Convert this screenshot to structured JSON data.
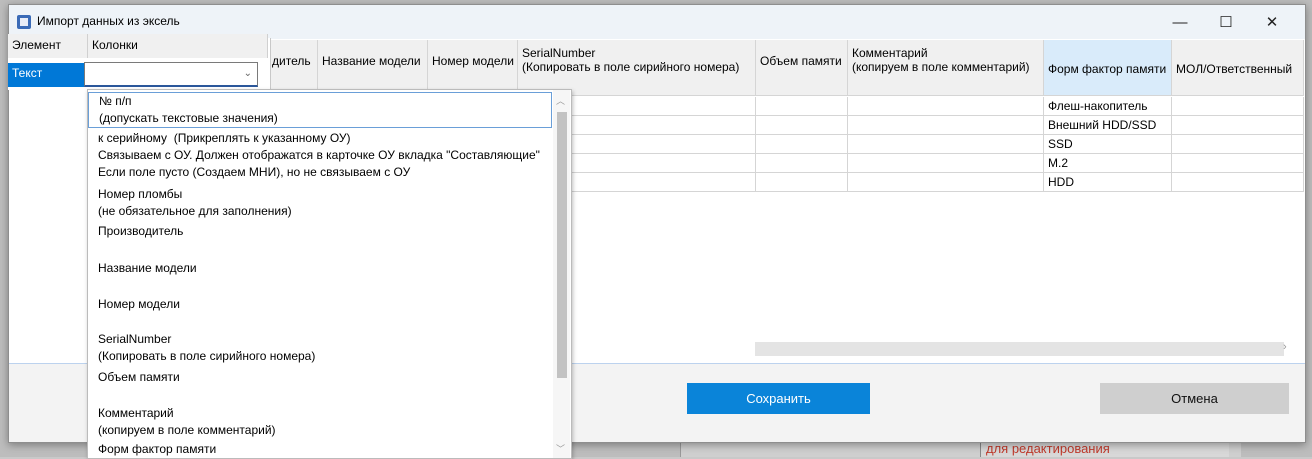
{
  "window": {
    "title": "Импорт данных из эксель",
    "minimize_glyph": "—",
    "maximize_glyph": "☐",
    "close_glyph": "✕"
  },
  "left_grid": {
    "col_element": "Элемент",
    "col_columns": "Колонки",
    "row_element": "Текст",
    "combo_value": "",
    "combo_arrow": "⌄"
  },
  "table": {
    "headers": [
      {
        "label": "дитель"
      },
      {
        "label": "Название модели"
      },
      {
        "label": "Номер модели"
      },
      {
        "label": "SerialNumber\n(Копировать в поле сирийного номера)"
      },
      {
        "label": "Объем памяти"
      },
      {
        "label": "Комментарий\n(копируем в поле комментарий)"
      },
      {
        "label": "Форм фактор памяти"
      },
      {
        "label": "МОЛ/Ответственный"
      }
    ],
    "form_factor_values": [
      "Флеш-накопитель",
      "Внешний HDD/SSD",
      "SSD",
      "M.2",
      "HDD"
    ]
  },
  "dropdown": {
    "items": [
      "№ п/п\n(допускать текстовые значения)",
      "к серийному  (Прикреплять к указанному ОУ)\nСвязываем с ОУ. Должен отображатся в карточке ОУ вкладка \"Составляющие\"\nЕсли поле пусто (Создаем МНИ), но не связываем с ОУ",
      "Номер пломбы\n(не обязательное для заполнения)",
      "Производитель",
      "Название модели",
      "Номер модели",
      "SerialNumber\n(Копировать в поле сирийного номера)",
      "Объем памяти",
      "Комментарий\n(копируем в поле комментарий)",
      "Форм фактор памяти"
    ]
  },
  "buttons": {
    "save": "Сохранить",
    "cancel": "Отмена"
  },
  "background": {
    "red_text": "для редактирования"
  }
}
